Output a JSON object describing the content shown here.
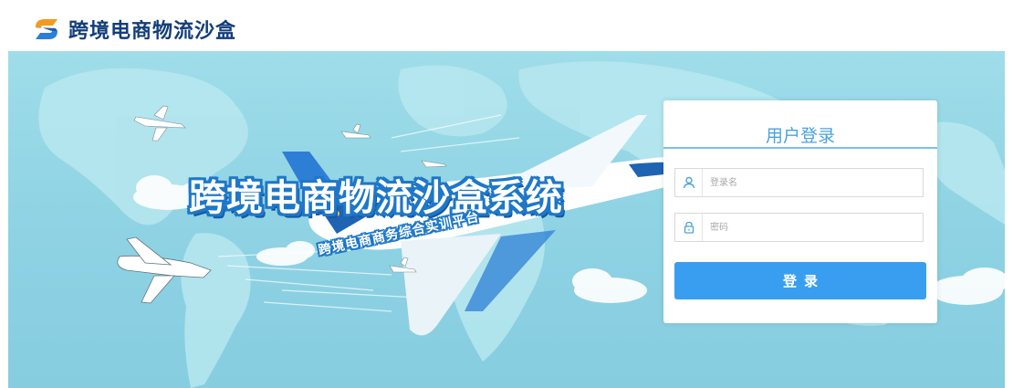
{
  "header": {
    "title": "跨境电商物流沙盒"
  },
  "banner": {
    "headline": "跨境电商物流沙盒系统",
    "subheadline": "跨境电商商务综合实训平台"
  },
  "login": {
    "title": "用户登录",
    "username_placeholder": "登录名",
    "password_placeholder": "密码",
    "button_label": "登录"
  },
  "colors": {
    "brand_orange": "#f39a1f",
    "brand_blue": "#2b7fd8",
    "accent": "#3a9ef0",
    "sky": "#9fdde9"
  }
}
